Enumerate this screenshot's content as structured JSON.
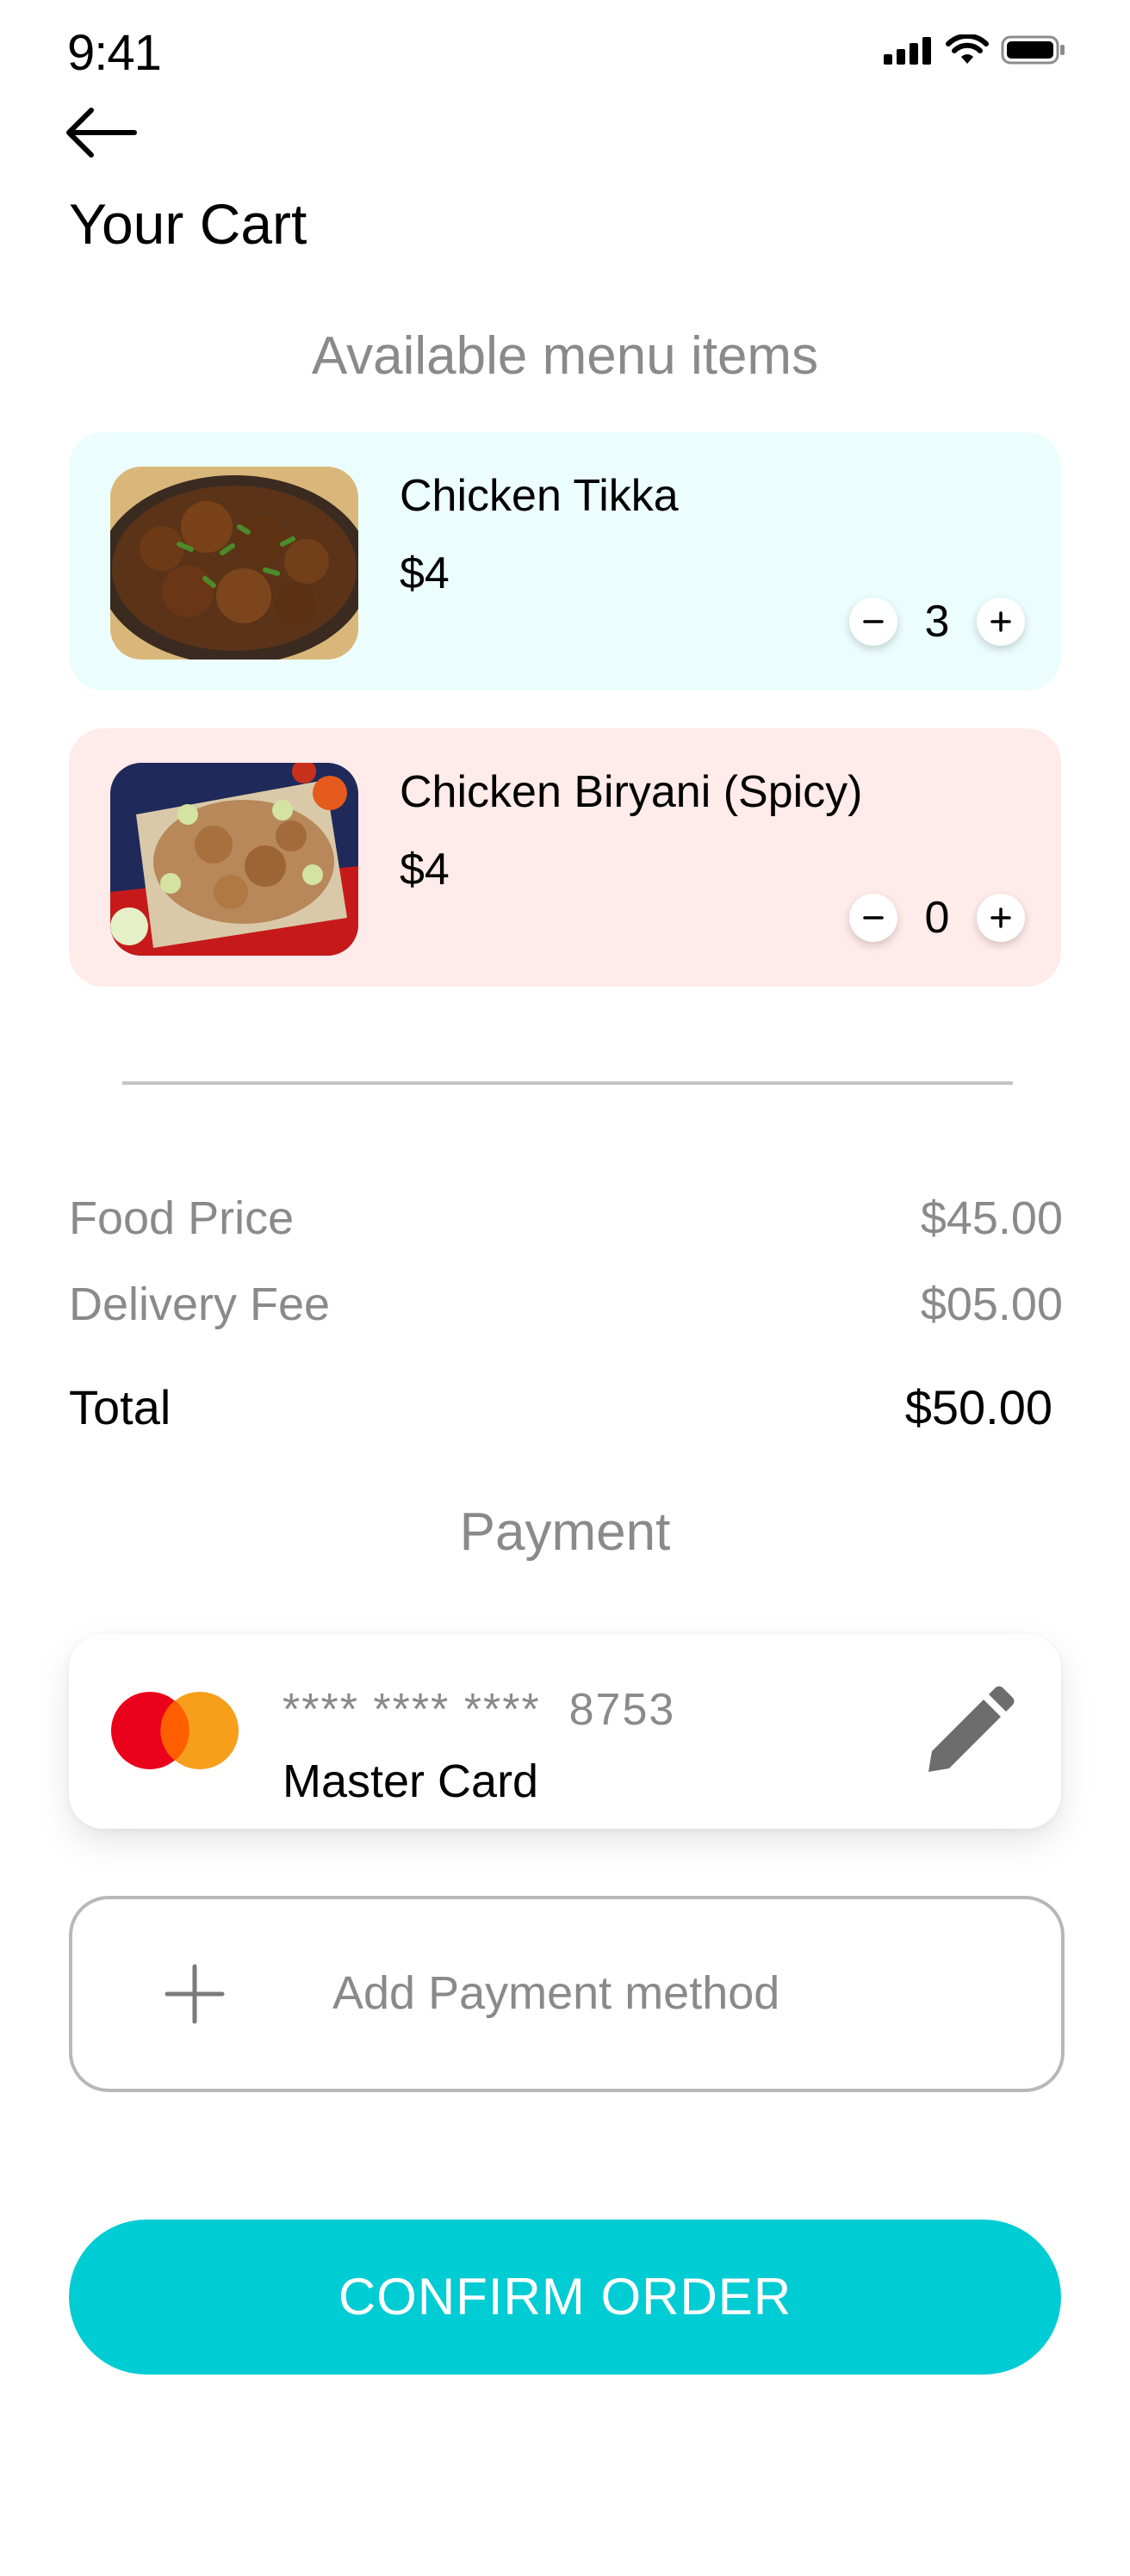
{
  "status_bar": {
    "time": "9:41"
  },
  "header": {
    "title": "Your Cart"
  },
  "menu": {
    "heading": "Available menu items",
    "items": [
      {
        "name": "Chicken Tikka",
        "price": "$4",
        "quantity": "3",
        "background": "#ecfdfd"
      },
      {
        "name": "Chicken Biryani (Spicy)",
        "price": "$4",
        "quantity": "0",
        "background": "#ffebea"
      }
    ]
  },
  "summary": {
    "food_price_label": "Food Price",
    "food_price_value": "$45.00",
    "delivery_fee_label": "Delivery Fee",
    "delivery_fee_value": "$05.00",
    "total_label": "Total",
    "total_value": "$50.00"
  },
  "payment": {
    "heading": "Payment",
    "card_number": "**** **** ****  8753",
    "card_name": "Master Card",
    "add_method_label": "Add Payment method"
  },
  "confirm_button": {
    "label": "CONFIRM ORDER"
  },
  "colors": {
    "accent": "#00ccd3",
    "muted_text": "#8a8a8a",
    "mastercard_red": "#eb001b",
    "mastercard_orange": "#f79e1b"
  },
  "icons": {
    "back": "arrow-left-icon",
    "edit": "pencil-icon",
    "add": "plus-icon",
    "decrement": "minus-icon",
    "increment": "plus-icon",
    "card_brand": "mastercard-icon"
  }
}
